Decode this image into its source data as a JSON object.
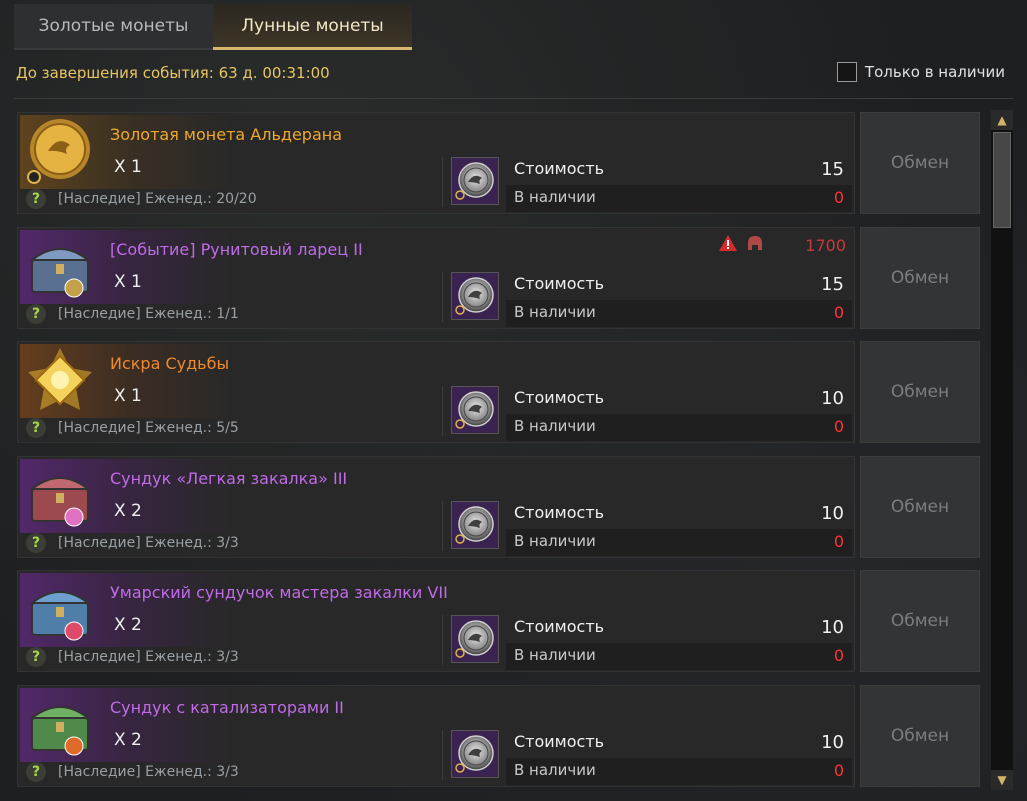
{
  "tabs": [
    {
      "label": "Золотые монеты",
      "active": false
    },
    {
      "label": "Лунные монеты",
      "active": true
    }
  ],
  "timer_text": "До завершения события: 63 д. 00:31:00",
  "filter": {
    "label": "Только в наличии",
    "checked": false
  },
  "common": {
    "cost_label": "Стоимость",
    "have_label": "В наличии",
    "exchange_label": "Обмен",
    "help_glyph": "?"
  },
  "items": [
    {
      "name": "Золотая монета Альдерана",
      "name_color": "#f0a92c",
      "bar": "gold",
      "icon": "gold-coin-icon",
      "qty": "X 1",
      "limit": "[Наследие] Еженед.: 20/20",
      "cost": "15",
      "have": "0"
    },
    {
      "name": "[Событие] Рунитовый ларец II",
      "name_color": "#c06be8",
      "bar": "purple",
      "icon": "rune-chest-icon",
      "qty": "X 1",
      "limit": "[Наследие] Еженед.: 1/1",
      "cost": "15",
      "have": "0",
      "warning_value": "1700"
    },
    {
      "name": "Искра Судьбы",
      "name_color": "#f08a2c",
      "bar": "orange",
      "icon": "spark-of-fate-icon",
      "qty": "X 1",
      "limit": "[Наследие] Еженед.: 5/5",
      "cost": "10",
      "have": "0"
    },
    {
      "name": "Сундук «Легкая закалка» III",
      "name_color": "#c06be8",
      "bar": "purple",
      "icon": "light-honing-chest-icon",
      "qty": "X 2",
      "limit": "[Наследие] Еженед.: 3/3",
      "cost": "10",
      "have": "0"
    },
    {
      "name": "Умарский сундучок мастера закалки VII",
      "name_color": "#c06be8",
      "bar": "purple",
      "icon": "honing-master-chest-icon",
      "qty": "X 2",
      "limit": "[Наследие] Еженед.: 3/3",
      "cost": "10",
      "have": "0"
    },
    {
      "name": "Сундук с катализаторами II",
      "name_color": "#c06be8",
      "bar": "purple",
      "icon": "catalyst-chest-icon",
      "qty": "X 2",
      "limit": "[Наследие] Еженед.: 3/3",
      "cost": "10",
      "have": "0"
    }
  ],
  "colors": {
    "accent_gold": "#d9b66d",
    "timer": "#e8c463",
    "red": "#ff3333",
    "help_green": "#a8d64a"
  }
}
